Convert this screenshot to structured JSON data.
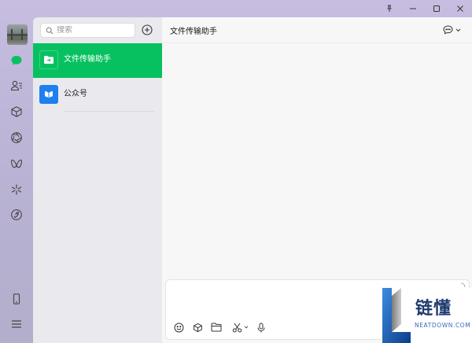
{
  "window": {
    "controls": [
      {
        "name": "pin",
        "icon": "pin-icon"
      },
      {
        "name": "minimize",
        "icon": "minimize-icon"
      },
      {
        "name": "maximize",
        "icon": "maximize-icon"
      },
      {
        "name": "close",
        "icon": "close-icon"
      }
    ]
  },
  "nav": {
    "items": [
      {
        "name": "chats",
        "icon": "chat-bubble-icon",
        "active": true
      },
      {
        "name": "contacts",
        "icon": "contacts-icon"
      },
      {
        "name": "favorites",
        "icon": "cube-icon"
      },
      {
        "name": "moments",
        "icon": "aperture-icon"
      },
      {
        "name": "channels",
        "icon": "butterfly-icon"
      },
      {
        "name": "search",
        "icon": "sparkle-icon"
      },
      {
        "name": "mini-programs",
        "icon": "link-icon"
      }
    ],
    "bottom": [
      {
        "name": "phone",
        "icon": "phone-icon"
      },
      {
        "name": "menu",
        "icon": "menu-icon"
      }
    ]
  },
  "search": {
    "placeholder": "搜索"
  },
  "chat_list": [
    {
      "name": "文件传输助手",
      "icon": "folder-icon",
      "active": true,
      "color": "#07c160"
    },
    {
      "name": "公众号",
      "icon": "official-account-icon",
      "active": false,
      "color": "#1e7ff0"
    }
  ],
  "chat": {
    "title": "文件传输助手",
    "toolbar": [
      "emoji-icon",
      "cube-icon",
      "folder-icon",
      "scissors-icon",
      "microphone-icon"
    ]
  },
  "watermark": {
    "title": "链懂",
    "subtitle": "NEATDOWN.COM"
  },
  "colors": {
    "accent": "#07c160",
    "official_account": "#1e7ff0"
  }
}
